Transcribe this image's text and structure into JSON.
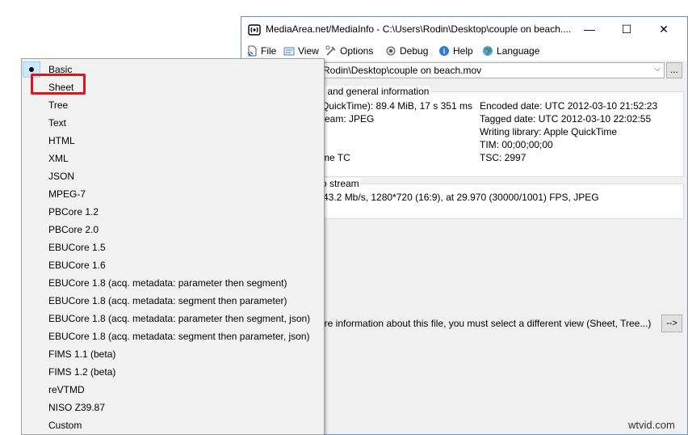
{
  "window": {
    "title": "MediaArea.net/MediaInfo - C:\\Users\\Rodin\\Desktop\\couple on beach....",
    "minimize": "—",
    "maximize": "☐",
    "close": "✕"
  },
  "menubar": {
    "items": [
      {
        "label": "File",
        "icon": "file-icon"
      },
      {
        "label": "View",
        "icon": "view-icon"
      },
      {
        "label": "Options",
        "icon": "options-icon"
      },
      {
        "label": "Debug",
        "icon": "debug-icon"
      },
      {
        "label": "Help",
        "icon": "help-icon"
      },
      {
        "label": "Language",
        "icon": "language-icon"
      }
    ]
  },
  "file_combo": {
    "value": "Rodin\\Desktop\\couple on beach.mov",
    "arrow": "⌵",
    "browse": "..."
  },
  "general": {
    "title": "r and general information",
    "left": [
      "QuickTime): 89.4 MiB, 17 s 351 ms",
      "ream: JPEG",
      "",
      "",
      "me TC"
    ],
    "right": [
      "Encoded date: UTC 2012-03-10 21:52:23",
      "Tagged date: UTC 2012-03-10 22:02:55",
      "Writing library: Apple QuickTime",
      "TIM: 00;00;00;00",
      "TSC: 2997"
    ]
  },
  "video": {
    "title": "o stream",
    "line": "43.2 Mb/s, 1280*720 (16:9), at 29.970 (30000/1001) FPS, JPEG"
  },
  "more_info": {
    "text": "ore information about this file, you must select a different view (Sheet, Tree...)",
    "button": "-->"
  },
  "view_menu": {
    "items": [
      {
        "label": "Basic",
        "checked": true
      },
      {
        "label": "Sheet"
      },
      {
        "label": "Tree"
      },
      {
        "label": "Text"
      },
      {
        "label": "HTML"
      },
      {
        "label": "XML"
      },
      {
        "label": "JSON"
      },
      {
        "label": "MPEG-7"
      },
      {
        "label": "PBCore 1.2"
      },
      {
        "label": "PBCore 2.0"
      },
      {
        "label": "EBUCore 1.5"
      },
      {
        "label": "EBUCore 1.6"
      },
      {
        "label": "EBUCore 1.8 (acq. metadata: parameter then segment)"
      },
      {
        "label": "EBUCore 1.8 (acq. metadata: segment then parameter)"
      },
      {
        "label": "EBUCore 1.8 (acq. metadata: parameter then segment, json)"
      },
      {
        "label": "EBUCore 1.8 (acq. metadata: segment then parameter, json)"
      },
      {
        "label": "FIMS 1.1 (beta)"
      },
      {
        "label": "FIMS 1.2 (beta)"
      },
      {
        "label": "reVTMD"
      },
      {
        "label": "NISO Z39.87"
      },
      {
        "label": "Custom"
      }
    ]
  },
  "watermark": "wtvid.com",
  "colors": {
    "highlight": "#cce8ff",
    "annotation_red": "#e0141c",
    "menu_bg": "#f2f2f2"
  }
}
